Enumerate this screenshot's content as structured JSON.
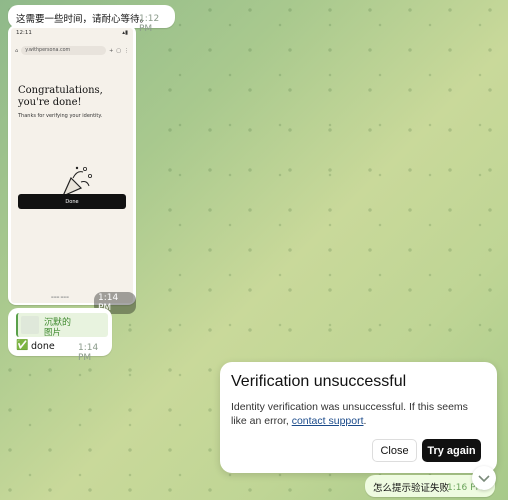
{
  "messages": {
    "first": {
      "text": "这需要一些时间，请耐心等待。",
      "time": "1:12 PM"
    },
    "screenshot": {
      "time": "1:14 PM"
    },
    "reply": {
      "quote_name": "沉默的",
      "quote_type": "图片",
      "text": "done",
      "time": "1:14 PM"
    },
    "last": {
      "text": "怎么提示验证失败",
      "time": "1:16 PM"
    }
  },
  "phone": {
    "status_time": "12:11",
    "url": "y.withpersona.com",
    "title": "Congratulations, you're done!",
    "subtitle": "Thanks for verifying your identity.",
    "done_label": "Done"
  },
  "dialog": {
    "title": "Verification unsuccessful",
    "body_prefix": "Identity verification was unsuccessful. If this seems like an error, ",
    "link": "contact support",
    "body_suffix": ".",
    "close_label": "Close",
    "try_label": "Try again"
  },
  "icons": {
    "check": "✅",
    "chevron": "chevron-down-icon"
  }
}
